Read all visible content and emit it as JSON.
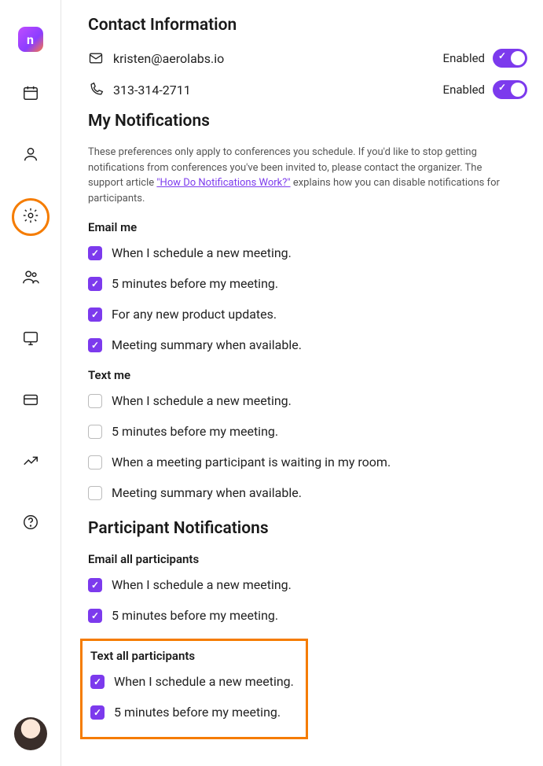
{
  "sidebar": {
    "logo_letter": "n"
  },
  "contact": {
    "title": "Contact Information",
    "email": "kristen@aerolabs.io",
    "phone": "313-314-2711",
    "email_status": "Enabled",
    "phone_status": "Enabled"
  },
  "my_notifications": {
    "title": "My Notifications",
    "help_pre": "These preferences only apply to conferences you schedule. If you'd like to stop getting notifications from conferences you've been invited to, please contact the organizer. The support article ",
    "help_link": "\"How Do Notifications Work?\"",
    "help_post": " explains how you can disable notifications for participants.",
    "email_me_heading": "Email me",
    "email_me": [
      {
        "label": "When I schedule a new meeting.",
        "checked": true
      },
      {
        "label": "5 minutes before my meeting.",
        "checked": true
      },
      {
        "label": "For any new product updates.",
        "checked": true
      },
      {
        "label": "Meeting summary when available.",
        "checked": true
      }
    ],
    "text_me_heading": "Text me",
    "text_me": [
      {
        "label": "When I schedule a new meeting.",
        "checked": false
      },
      {
        "label": "5 minutes before my meeting.",
        "checked": false
      },
      {
        "label": "When a meeting participant is waiting in my room.",
        "checked": false
      },
      {
        "label": "Meeting summary when available.",
        "checked": false
      }
    ]
  },
  "participant_notifications": {
    "title": "Participant Notifications",
    "email_all_heading": "Email all participants",
    "email_all": [
      {
        "label": "When I schedule a new meeting.",
        "checked": true
      },
      {
        "label": "5 minutes before my meeting.",
        "checked": true
      }
    ],
    "text_all_heading": "Text all participants",
    "text_all": [
      {
        "label": "When I schedule a new meeting.",
        "checked": true
      },
      {
        "label": "5 minutes before my meeting.",
        "checked": true
      }
    ]
  }
}
